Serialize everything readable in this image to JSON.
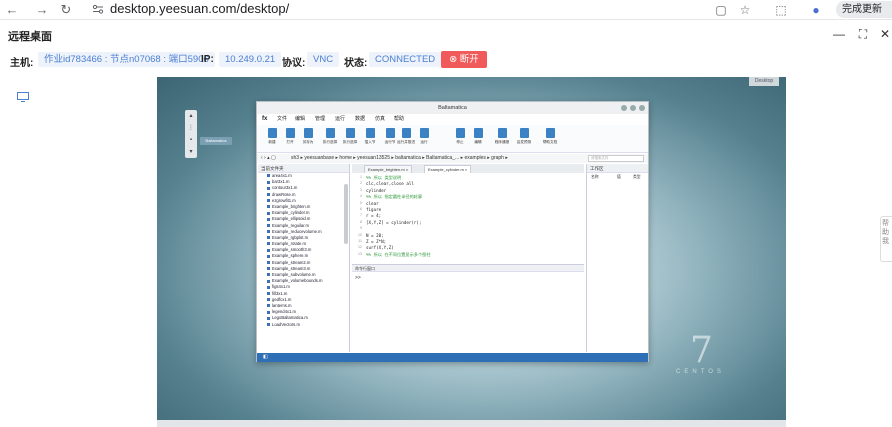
{
  "browser": {
    "url": "desktop.yeesuan.com/desktop/",
    "update_label": "完成更新"
  },
  "app": {
    "title": "远程桌面"
  },
  "info": {
    "host_label": "主机:",
    "host_value": "作业id783466 : 节点n07068 : 端口5906",
    "ip_label": "IP:",
    "ip_value": "10.249.0.21",
    "protocol_label": "协议:",
    "protocol_value": "VNC",
    "status_label": "状态:",
    "status_value": "CONNECTED",
    "disconnect_label": "断开"
  },
  "remote": {
    "os_logo_text": "CENTOS",
    "os_logo_number": "7",
    "window": {
      "title": "Baltamatica",
      "menu": [
        "文件",
        "编辑",
        "管理",
        "运行",
        "数据",
        "仿真",
        "帮助"
      ],
      "ribbon": [
        "新建",
        "打开",
        "另存为",
        "执行选择",
        "执行选择",
        "插入节",
        "运行节",
        "运行并推进",
        "运行",
        "停止",
        "编辑",
        "程序通报",
        "启发预测",
        "帮助文档"
      ],
      "path": "sh3 ▸ yeesuanbase ▸ home ▸ yeesuan13525 ▸ baltamatica ▸ Baltamatica_... ▸ examples ▸ graph ▸",
      "search_placeholder": "请搜索文件",
      "left_panel_title": "当前文件夹",
      "files": [
        "area4x1.m",
        "bar3x1.m",
        "contour3x1.m",
        "drawRose.m",
        "ezgrowfit1.m",
        "Example_brighten.m",
        "Example_cylinder.m",
        "Example_ellipsoid.m",
        "Example_reguilar.m",
        "Example_reducevolume.m",
        "Example_rgbplot.m",
        "Example_rotate.m",
        "Example_smooth3.m",
        "Example_sphere.m",
        "Example_stream2.m",
        "Example_stream3.m",
        "Example_subvolume.m",
        "Example_volumebounds.m",
        "figs4x1.m",
        "fill3x1.m",
        "gedfcx1.m",
        "lanterns.m",
        "legend4x1.m",
        "LegoBaltamatica.m",
        "LoadVectors.m"
      ],
      "tabs": [
        "Example_brighten.m ×",
        "Example_cylinder.m ×"
      ],
      "code": [
        {
          "text": "%% 所以 类型说明",
          "comment": true
        },
        {
          "text": "clc,clear,close all",
          "comment": false
        },
        {
          "text": "cylinder",
          "comment": false
        },
        {
          "text": "%% 所以 指定圆柱半径的轮廓",
          "comment": true
        },
        {
          "text": "clear",
          "comment": false
        },
        {
          "text": "figure",
          "comment": false
        },
        {
          "text": "r = 4;",
          "comment": false
        },
        {
          "text": "[X,Y,Z] = cylinder(r);",
          "comment": false
        },
        {
          "text": "",
          "comment": false
        },
        {
          "text": "N = 20;",
          "comment": false
        },
        {
          "text": "Z = Z*N;",
          "comment": false
        },
        {
          "text": "surf(X,Y,Z)",
          "comment": false
        },
        {
          "text": "%% 所以 在不同位置显示多个图柱",
          "comment": true
        }
      ],
      "cmd_title": "命令行窗口",
      "prompt": ">>",
      "workspace_title": "工作区",
      "workspace_cols": [
        "名称",
        "值",
        "类型"
      ]
    }
  }
}
